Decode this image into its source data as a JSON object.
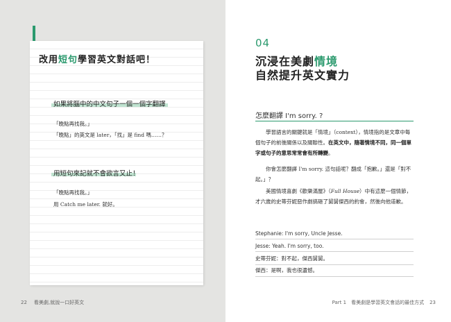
{
  "left_page": {
    "card_heading_pre": "改用",
    "card_heading_highlight": "短句",
    "card_heading_post": "學習英文對話吧！",
    "subheading1": "如果將腦中的中文句子一個一個字翻譯",
    "block1_line1": "「晚點再找我。」",
    "block1_line2": "「晚點」的英文是 later，「找」是 find 嗎……？",
    "subheading2": "用短句來記就不會欲言又止！",
    "block2_line1": "「晚點再找我。」",
    "block2_line2": "用 Catch me later. 就好。",
    "footer_page_number": "22",
    "footer_book_title": "看美劇,就說一口好英文"
  },
  "right_page": {
    "chapter_number": "04",
    "chapter_title_line1_pre": "沉浸在美劇",
    "chapter_title_line1_highlight": "情境",
    "chapter_title_line2": "自然提升英文實力",
    "section_title": "怎麼翻譯 I'm sorry. ?",
    "para1_normal": "學習語言的關鍵就是「情境」（context），情境指的是文章中每個句子的前後關係以及關聯性。",
    "para1_bold": "在英文中，隨著情境不同，同一個單字或句子的意思常常會有所轉變",
    "para1_end": "。",
    "para2": "你會怎麼翻譯 I'm sorry. 這句話呢？翻成「抱歉。」還是「對不起。」？",
    "para3_pre": "美國情境喜劇《歡樂滿屋》（",
    "para3_italic": "Full House",
    "para3_post": "）中有這麼一個情節，才六歲的史蒂芬妮惡作劇搞砸了舅舅傑西的約會，然後向他道歉。",
    "dialogue": [
      "Stephanie: I'm sorry, Uncle Jesse.",
      "Jesse: Yeah. I'm sorry, too.",
      "史蒂芬妮：對不起，傑西舅舅。",
      "傑西：是啊，我也很遺憾。"
    ],
    "footer_part": "Part 1　看美劇是學習英文會話的最佳方式",
    "footer_page_number": "23"
  },
  "colors": {
    "accent_green": "#2b9a6e",
    "highlight_green": "#bfe3d0",
    "left_page_background": "#e4e4e2"
  }
}
